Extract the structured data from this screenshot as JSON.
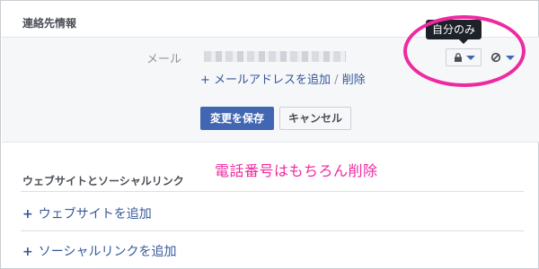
{
  "contact": {
    "section_title": "連絡先情報",
    "email_label": "メール",
    "add_email_link": "+ メールアドレスを追加",
    "separator": " / ",
    "delete_link": "削除",
    "tooltip": "自分のみ",
    "save_label": "変更を保存",
    "cancel_label": "キャンセル"
  },
  "annotation": {
    "note": "電話番号はもちろん削除",
    "color": "#ee2aa0"
  },
  "links": {
    "section_title": "ウェブサイトとソーシャルリンク",
    "add_website": "ウェブサイトを追加",
    "add_social": "ソーシャルリンクを追加"
  },
  "icons": {
    "privacy": "lock-icon",
    "block": "block-icon",
    "dropdown": "chevron-down-icon"
  },
  "colors": {
    "accent": "#4267b2",
    "link": "#365899"
  }
}
